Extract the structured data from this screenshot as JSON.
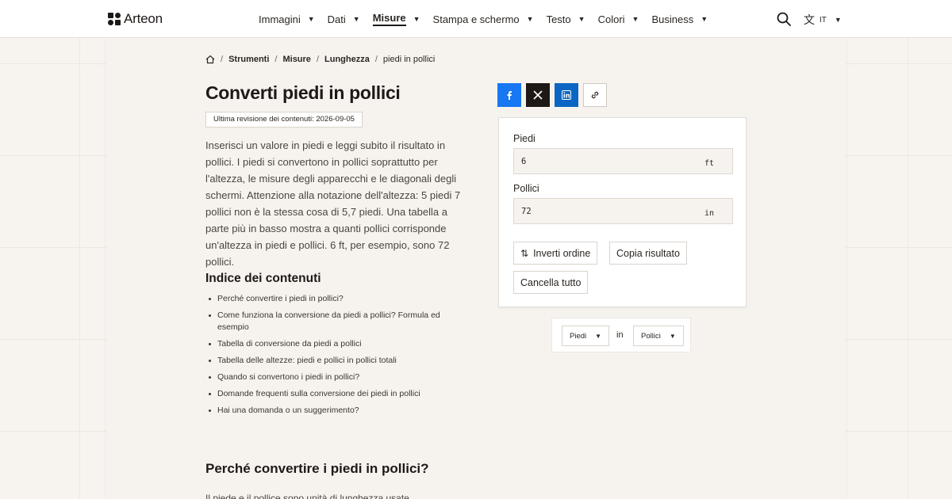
{
  "brand": {
    "name": "Arteon"
  },
  "nav": {
    "items": [
      {
        "label": "Immagini",
        "active": false
      },
      {
        "label": "Dati",
        "active": false
      },
      {
        "label": "Misure",
        "active": true
      },
      {
        "label": "Stampa e schermo",
        "active": false
      },
      {
        "label": "Testo",
        "active": false
      },
      {
        "label": "Colori",
        "active": false
      },
      {
        "label": "Business",
        "active": false
      }
    ],
    "language": "IT"
  },
  "breadcrumb": {
    "items": [
      "Strumenti",
      "Misure",
      "Lunghezza",
      "piedi in pollici"
    ]
  },
  "page": {
    "title": "Converti piedi in pollici",
    "revision": "Ultima revisione dei contenuti: 2026-09-05",
    "intro": "Inserisci un valore in piedi e leggi subito il risultato in pollici. I piedi si convertono in pollici soprattutto per l'altezza, le misure degli apparecchi e le diagonali degli schermi. Attenzione alla notazione dell'altezza: 5 piedi 7 pollici non è la stessa cosa di 5,7 piedi. Una tabella a parte più in basso mostra a quanti pollici corrisponde un'altezza in piedi e pollici. 6 ft, per esempio, sono 72 pollici."
  },
  "toc": {
    "title": "Indice dei contenuti",
    "items": [
      "Perché convertire i piedi in pollici?",
      "Come funziona la conversione da piedi a pollici? Formula ed esempio",
      "Tabella di conversione da piedi a pollici",
      "Tabella delle altezze: piedi e pollici in pollici totali",
      "Quando si convertono i piedi in pollici?",
      "Domande frequenti sulla conversione dei piedi in pollici",
      "Hai una domanda o un suggerimento?"
    ]
  },
  "section": {
    "title": "Perché convertire i piedi in pollici?",
    "text_start": "Il piede e il pollice sono unità di lunghezza usate"
  },
  "share": {
    "icons": [
      "facebook-icon",
      "x-icon",
      "linkedin-icon",
      "link-icon"
    ]
  },
  "converter": {
    "from_label": "Piedi",
    "from_value": "6",
    "from_unit": "ft",
    "to_label": "Pollici",
    "to_value": "72",
    "to_unit": "in",
    "swap_label": "Inverti ordine",
    "copy_label": "Copia risultato",
    "clear_label": "Cancella tutto"
  },
  "unit_select": {
    "from": "Piedi",
    "connector": "in",
    "to": "Pollici"
  },
  "colors": {
    "facebook": "#1877f2",
    "x": "#1c1917",
    "linkedin": "#0a66c2",
    "page_bg": "#f6f3ef"
  }
}
